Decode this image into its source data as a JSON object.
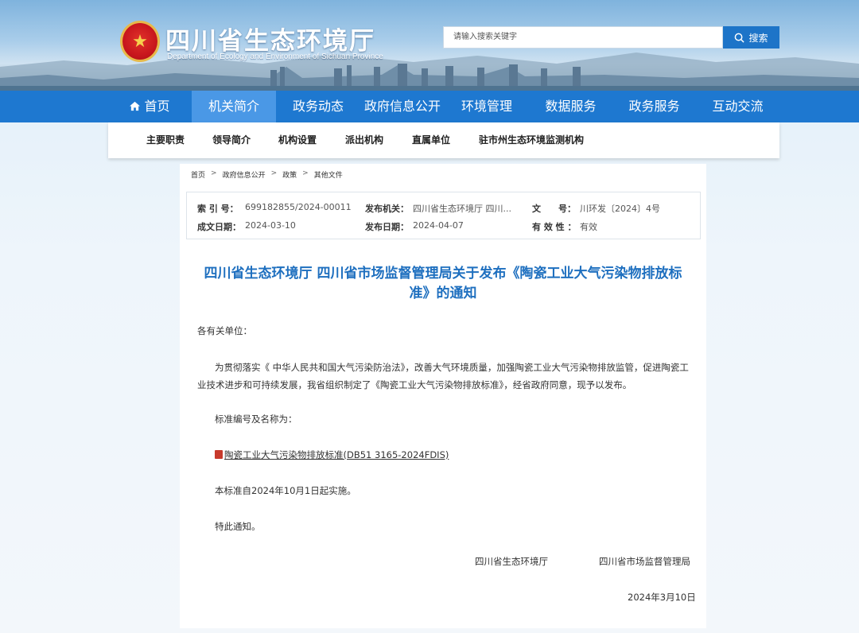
{
  "header": {
    "site_title": "四川省生态环境厅",
    "site_subtitle": "Department of Ecology and Environment of Sichuan Province",
    "search_placeholder": "请输入搜索关键字",
    "search_button": "搜索"
  },
  "mainnav": {
    "items": [
      {
        "label": "首页"
      },
      {
        "label": "机关简介"
      },
      {
        "label": "政务动态"
      },
      {
        "label": "政府信息公开"
      },
      {
        "label": "环境管理"
      },
      {
        "label": "数据服务"
      },
      {
        "label": "政务服务"
      },
      {
        "label": "互动交流"
      }
    ]
  },
  "subnav": {
    "items": [
      {
        "label": "主要职责"
      },
      {
        "label": "领导简介"
      },
      {
        "label": "机构设置"
      },
      {
        "label": "派出机构"
      },
      {
        "label": "直属单位"
      },
      {
        "label": "驻市州生态环境监测机构"
      }
    ]
  },
  "breadcrumb": [
    "首页",
    "政府信息公开",
    "政策",
    "其他文件"
  ],
  "meta": {
    "index_label": "索 引 号：",
    "index_value": "699182855/2024-00011",
    "publisher_label": "发布机关：",
    "publisher_value": "四川省生态环境厅 四川...",
    "docno_label": "文　　号：",
    "docno_value": "川环发〔2024〕4号",
    "created_label": "成文日期：",
    "created_value": "2024-03-10",
    "published_label": "发布日期：",
    "published_value": "2024-04-07",
    "validity_label": "有 效 性 ：",
    "validity_value": "有效"
  },
  "doc": {
    "title": "四川省生态环境厅 四川省市场监督管理局关于发布《陶瓷工业大气污染物排放标准》的通知",
    "salutation": "各有关单位：",
    "body_line1": "为贯彻落实《 中华人民共和国大气污染防治法》，改善大气环境质量，加强陶瓷工业大气污染物排放监管，促进陶瓷工",
    "body_line2": "业技术进步和可持续发展，我省组织制定了《陶瓷工业大气污染物排放标准》，经省政府同意，现予以发布。",
    "standard_intro": "标准编号及名称为：",
    "attachment": "陶瓷工业大气污染物排放标准(DB51 3165-2024FDIS)",
    "effective": "本标准自2024年10月1日起实施。",
    "closing": "特此通知。",
    "signer1": "四川省生态环境厅",
    "signer2": "四川省市场监督管理局",
    "date": "2024年3月10日"
  },
  "colors": {
    "nav": "#1e78d0",
    "nav_active": "#4a98e6",
    "title": "#1e6fbf",
    "search_button": "#1d74c8"
  },
  "icons": {
    "home": "home-icon",
    "search": "search-icon",
    "emblem": "national-emblem-icon",
    "attachment": "pdf-file-icon"
  }
}
